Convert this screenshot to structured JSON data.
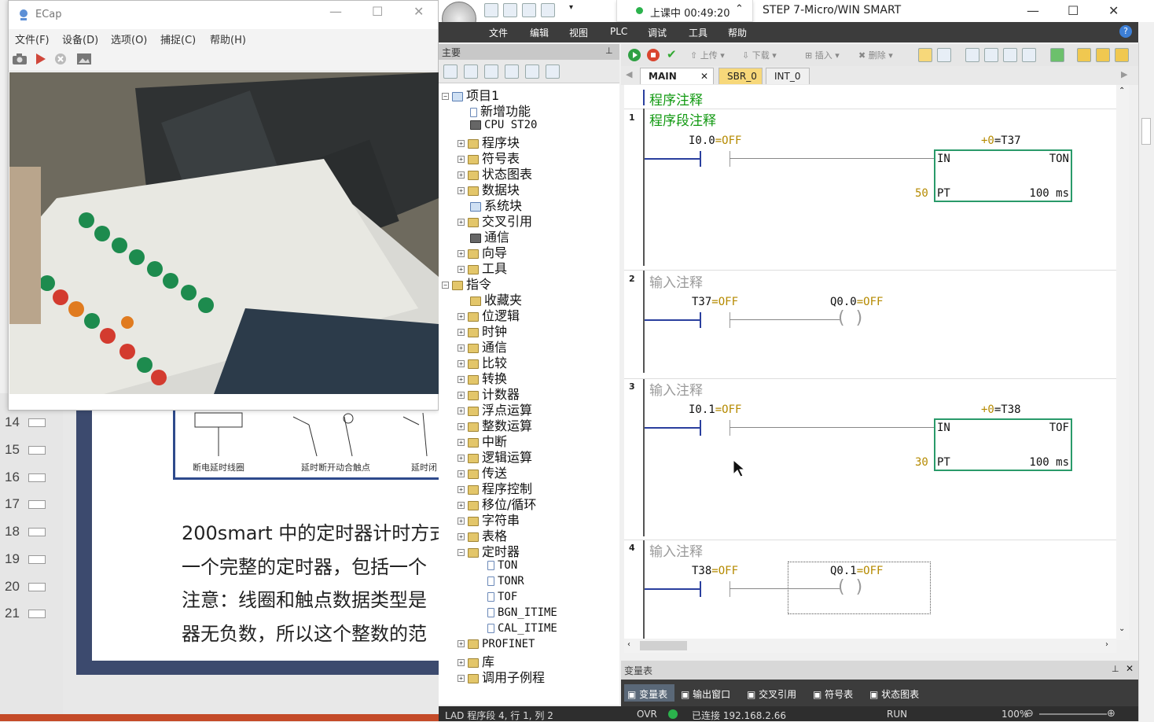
{
  "ppt": {
    "slide_numbers": [
      "14",
      "15",
      "16",
      "17",
      "18",
      "19",
      "20",
      "21"
    ],
    "captions": [
      "断电延时线圈",
      "延时断开动合触点",
      "延时闭"
    ],
    "lines": [
      "200smart 中的定时器计时方式",
      "一个完整的定时器，包括一个",
      "注意：线圈和触点数据类型是",
      "器无负数，所以这个整数的范"
    ]
  },
  "ecap": {
    "title": "ECap",
    "menu": [
      "文件(F)",
      "设备(D)",
      "选项(O)",
      "捕捉(C)",
      "帮助(H)"
    ]
  },
  "step7": {
    "title": "STEP 7-Micro/WIN SMART",
    "banner": "上课中 00:49:20",
    "menu": [
      "文件",
      "编辑",
      "视图",
      "PLC",
      "调试",
      "工具",
      "帮助"
    ],
    "toolbar": {
      "upload": "上传",
      "download": "下载",
      "insert": "插入",
      "delete": "删除"
    },
    "tree_header": "主要",
    "tree": [
      {
        "label": "项目1",
        "level": 0
      },
      {
        "label": "新增功能",
        "level": 1
      },
      {
        "label": "CPU ST20",
        "level": 1
      },
      {
        "label": "程序块",
        "level": 1
      },
      {
        "label": "符号表",
        "level": 1
      },
      {
        "label": "状态图表",
        "level": 1
      },
      {
        "label": "数据块",
        "level": 1
      },
      {
        "label": "系统块",
        "level": 1
      },
      {
        "label": "交叉引用",
        "level": 1
      },
      {
        "label": "通信",
        "level": 1
      },
      {
        "label": "向导",
        "level": 1
      },
      {
        "label": "工具",
        "level": 1
      },
      {
        "label": "指令",
        "level": 0
      },
      {
        "label": "收藏夹",
        "level": 1
      },
      {
        "label": "位逻辑",
        "level": 1
      },
      {
        "label": "时钟",
        "level": 1
      },
      {
        "label": "通信",
        "level": 1
      },
      {
        "label": "比较",
        "level": 1
      },
      {
        "label": "转换",
        "level": 1
      },
      {
        "label": "计数器",
        "level": 1
      },
      {
        "label": "浮点运算",
        "level": 1
      },
      {
        "label": "整数运算",
        "level": 1
      },
      {
        "label": "中断",
        "level": 1
      },
      {
        "label": "逻辑运算",
        "level": 1
      },
      {
        "label": "传送",
        "level": 1
      },
      {
        "label": "程序控制",
        "level": 1
      },
      {
        "label": "移位/循环",
        "level": 1
      },
      {
        "label": "字符串",
        "level": 1
      },
      {
        "label": "表格",
        "level": 1
      },
      {
        "label": "定时器",
        "level": 1
      },
      {
        "label": "TON",
        "level": 2
      },
      {
        "label": "TONR",
        "level": 2
      },
      {
        "label": "TOF",
        "level": 2
      },
      {
        "label": "BGN_ITIME",
        "level": 2
      },
      {
        "label": "CAL_ITIME",
        "level": 2
      },
      {
        "label": "PROFINET",
        "level": 1
      },
      {
        "label": "库",
        "level": 1
      },
      {
        "label": "调用子例程",
        "level": 1
      }
    ],
    "editor_tabs": [
      "MAIN",
      "SBR_0",
      "INT_0"
    ],
    "program_comment": "程序注释",
    "networks": [
      {
        "num": "1",
        "comment": "程序段注释",
        "contact": "I0.0",
        "contact_state": "=OFF",
        "box_value": "+0",
        "box_timer": "=T37",
        "box_in": "IN",
        "box_type": "TON",
        "pt_value": "50",
        "box_pt": "PT",
        "box_res": "100 ms"
      },
      {
        "num": "2",
        "comment": "输入注释",
        "contact": "T37",
        "contact_state": "=OFF",
        "coil": "Q0.0",
        "coil_state": "=OFF"
      },
      {
        "num": "3",
        "comment": "输入注释",
        "contact": "I0.1",
        "contact_state": "=OFF",
        "box_value": "+0",
        "box_timer": "=T38",
        "box_in": "IN",
        "box_type": "TOF",
        "pt_value": "30",
        "box_pt": "PT",
        "box_res": "100 ms"
      },
      {
        "num": "4",
        "comment": "输入注释",
        "contact": "T38",
        "contact_state": "=OFF",
        "coil": "Q0.1",
        "coil_state": "=OFF"
      }
    ],
    "var_panel_title": "变量表",
    "bottom_tabs": [
      "变量表",
      "输出窗口",
      "交叉引用",
      "符号表",
      "状态图表"
    ],
    "status": {
      "mode": "LAD 程序段 4, 行 1, 列 2",
      "ovr": "OVR",
      "conn": "已连接 192.168.2.66",
      "run": "RUN",
      "zoom": "100%"
    }
  }
}
